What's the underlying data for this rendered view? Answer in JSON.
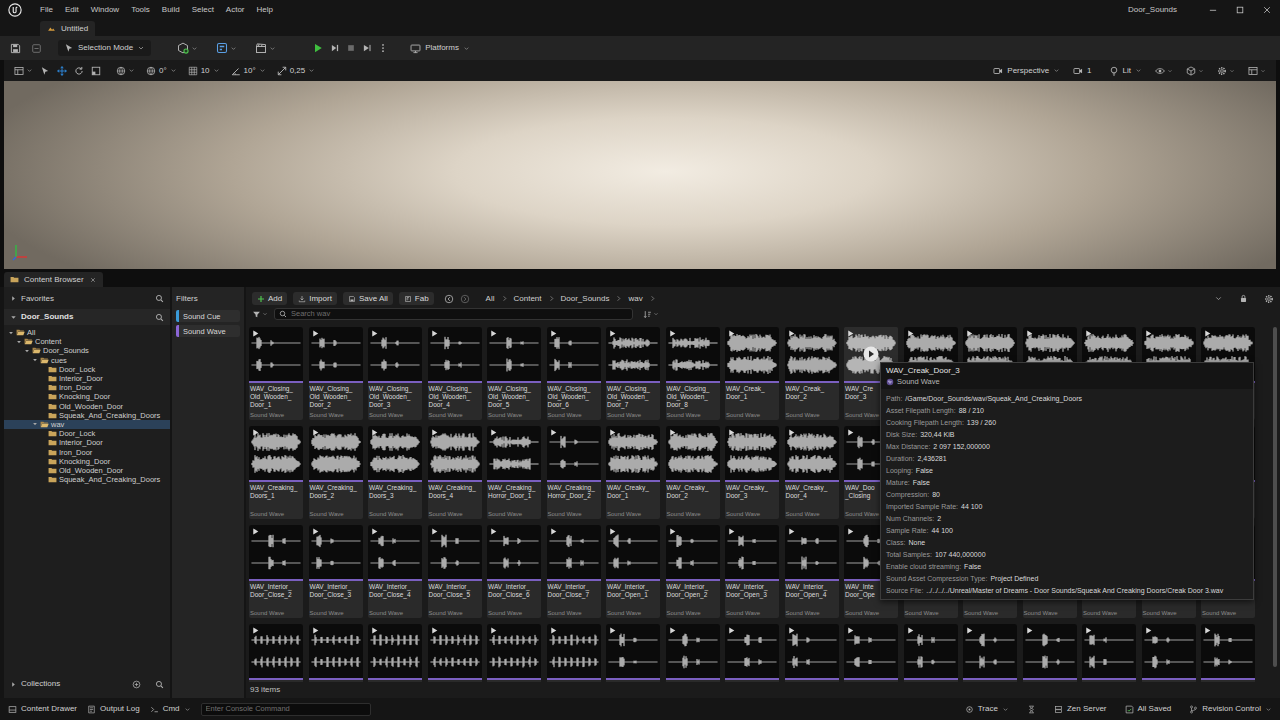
{
  "window": {
    "title": "Door_Sounds"
  },
  "menu": [
    "File",
    "Edit",
    "Window",
    "Tools",
    "Build",
    "Select",
    "Actor",
    "Help"
  ],
  "document_tab": {
    "label": "Untitled"
  },
  "main_toolbar": {
    "mode": "Selection Mode",
    "platforms": "Platforms"
  },
  "viewport_toolbar": {
    "snaps": [
      "0°",
      "10",
      "10°",
      "0,25"
    ],
    "camera": "Perspective",
    "speed": "1",
    "view_mode": "Lit"
  },
  "content_browser": {
    "tab": "Content Browser",
    "favorites": "Favorites",
    "root": "Door_Sounds",
    "tree": [
      {
        "label": "All",
        "depth": 0,
        "kind": "branch",
        "expanded": true,
        "selected": false
      },
      {
        "label": "Content",
        "depth": 1,
        "kind": "branch",
        "expanded": true,
        "selected": false
      },
      {
        "label": "Door_Sounds",
        "depth": 2,
        "kind": "branch",
        "expanded": true,
        "selected": false
      },
      {
        "label": "cues",
        "depth": 3,
        "kind": "branch",
        "expanded": true,
        "selected": false
      },
      {
        "label": "Door_Lock",
        "depth": 4,
        "kind": "leaf",
        "expanded": false,
        "selected": false
      },
      {
        "label": "Interior_Door",
        "depth": 4,
        "kind": "leaf",
        "expanded": false,
        "selected": false
      },
      {
        "label": "Iron_Door",
        "depth": 4,
        "kind": "leaf",
        "expanded": false,
        "selected": false
      },
      {
        "label": "Knocking_Door",
        "depth": 4,
        "kind": "leaf",
        "expanded": false,
        "selected": false
      },
      {
        "label": "Old_Wooden_Door",
        "depth": 4,
        "kind": "leaf",
        "expanded": false,
        "selected": false
      },
      {
        "label": "Squeak_And_Creaking_Doors",
        "depth": 4,
        "kind": "leaf",
        "expanded": false,
        "selected": false
      },
      {
        "label": "wav",
        "depth": 3,
        "kind": "branch",
        "expanded": true,
        "selected": true
      },
      {
        "label": "Door_Lock",
        "depth": 4,
        "kind": "leaf",
        "expanded": false,
        "selected": false
      },
      {
        "label": "Interior_Door",
        "depth": 4,
        "kind": "leaf",
        "expanded": false,
        "selected": false
      },
      {
        "label": "Iron_Door",
        "depth": 4,
        "kind": "leaf",
        "expanded": false,
        "selected": false
      },
      {
        "label": "Knocking_Door",
        "depth": 4,
        "kind": "leaf",
        "expanded": false,
        "selected": false
      },
      {
        "label": "Old_Wooden_Door",
        "depth": 4,
        "kind": "leaf",
        "expanded": false,
        "selected": false
      },
      {
        "label": "Squeak_And_Creaking_Doors",
        "depth": 4,
        "kind": "leaf",
        "expanded": false,
        "selected": false
      }
    ],
    "collections": "Collections",
    "filters_title": "Filters",
    "filters": [
      {
        "label": "Sound Cue",
        "color": "#3a9bd9"
      },
      {
        "label": "Sound Wave",
        "color": "#8b66d6"
      }
    ],
    "actions": [
      "Add",
      "Import",
      "Save All",
      "Fab"
    ],
    "breadcrumb": [
      "All",
      "Content",
      "Door_Sounds",
      "wav"
    ],
    "search": {
      "placeholder": "Search wav"
    },
    "tiles": [
      {
        "lines": [
          "WAV_Closing_",
          "Old_Wooden_",
          "Door_1"
        ],
        "type": "Sound Wave",
        "kind": "sparse",
        "hovered": false
      },
      {
        "lines": [
          "WAV_Closing_",
          "Old_Wooden_",
          "Door_2"
        ],
        "type": "Sound Wave",
        "kind": "sparse",
        "hovered": false
      },
      {
        "lines": [
          "WAV_Closing_",
          "Old_Wooden_",
          "Door_3"
        ],
        "type": "Sound Wave",
        "kind": "sparse",
        "hovered": false
      },
      {
        "lines": [
          "WAV_Closing_",
          "Old_Wooden_",
          "Door_4"
        ],
        "type": "Sound Wave",
        "kind": "sparse",
        "hovered": false
      },
      {
        "lines": [
          "WAV_Closing_",
          "Old_Wooden_",
          "Door_5"
        ],
        "type": "Sound Wave",
        "kind": "sparse",
        "hovered": false
      },
      {
        "lines": [
          "WAV_Closing_",
          "Old_Wooden_",
          "Door_6"
        ],
        "type": "Sound Wave",
        "kind": "sparse",
        "hovered": false
      },
      {
        "lines": [
          "WAV_Closing_",
          "Old_Wooden_",
          "Door_7"
        ],
        "type": "Sound Wave",
        "kind": "burst",
        "hovered": false
      },
      {
        "lines": [
          "WAV_Closing_",
          "Old_Wooden_",
          "Door_8"
        ],
        "type": "Sound Wave",
        "kind": "burst",
        "hovered": false
      },
      {
        "lines": [
          "WAV_Creak_",
          "Door_1"
        ],
        "type": "Sound Wave",
        "kind": "dense",
        "hovered": false
      },
      {
        "lines": [
          "WAV_Creak_",
          "Door_2"
        ],
        "type": "Sound Wave",
        "kind": "dense",
        "hovered": false
      },
      {
        "lines": [
          "WAV_Cre",
          "Door_3"
        ],
        "type": "Sound Wave",
        "kind": "dense",
        "hovered": true
      },
      {
        "lines": [],
        "type": "",
        "kind": "dense",
        "hovered": false
      },
      {
        "lines": [],
        "type": "",
        "kind": "dense",
        "hovered": false
      },
      {
        "lines": [],
        "type": "",
        "kind": "dense",
        "hovered": false
      },
      {
        "lines": [],
        "type": "",
        "kind": "dense",
        "hovered": false
      },
      {
        "lines": [],
        "type": "",
        "kind": "dense",
        "hovered": false
      },
      {
        "lines": [],
        "type": "",
        "kind": "dense",
        "hovered": false
      },
      {
        "lines": [
          "WAV_Creaking_",
          "Doors_1"
        ],
        "type": "Sound Wave",
        "kind": "dense",
        "hovered": false
      },
      {
        "lines": [
          "WAV_Creaking_",
          "Doors_2"
        ],
        "type": "Sound Wave",
        "kind": "dense",
        "hovered": false
      },
      {
        "lines": [
          "WAV_Creaking_",
          "Doors_3"
        ],
        "type": "Sound Wave",
        "kind": "dense",
        "hovered": false
      },
      {
        "lines": [
          "WAV_Creaking_",
          "Doors_4"
        ],
        "type": "Sound Wave",
        "kind": "dense",
        "hovered": false
      },
      {
        "lines": [
          "WAV_Creaking_",
          "Horror_Door_1"
        ],
        "type": "Sound Wave",
        "kind": "burst",
        "hovered": false
      },
      {
        "lines": [
          "WAV_Creaking_",
          "Horror_Door_2"
        ],
        "type": "Sound Wave",
        "kind": "sparse",
        "hovered": false
      },
      {
        "lines": [
          "WAV_Creaky_",
          "Door_1"
        ],
        "type": "Sound Wave",
        "kind": "dense",
        "hovered": false
      },
      {
        "lines": [
          "WAV_Creaky_",
          "Door_2"
        ],
        "type": "Sound Wave",
        "kind": "dense",
        "hovered": false
      },
      {
        "lines": [
          "WAV_Creaky_",
          "Door_3"
        ],
        "type": "Sound Wave",
        "kind": "dense",
        "hovered": false
      },
      {
        "lines": [
          "WAV_Creaky_",
          "Door_4"
        ],
        "type": "Sound Wave",
        "kind": "dense",
        "hovered": false
      },
      {
        "lines": [
          "WAV_Doo",
          "_Closing"
        ],
        "type": "Sound Wave",
        "kind": "sparse",
        "hovered": false
      },
      {
        "lines": [],
        "type": "",
        "kind": "dense",
        "hovered": false
      },
      {
        "lines": [],
        "type": "",
        "kind": "dense",
        "hovered": false
      },
      {
        "lines": [],
        "type": "",
        "kind": "dense",
        "hovered": false
      },
      {
        "lines": [],
        "type": "",
        "kind": "dense",
        "hovered": false
      },
      {
        "lines": [],
        "type": "",
        "kind": "dense",
        "hovered": false
      },
      {
        "lines": [],
        "type": "",
        "kind": "dense",
        "hovered": false
      },
      {
        "lines": [
          "WAV_Interior_",
          "Door_Close_2"
        ],
        "type": "Sound Wave",
        "kind": "sparse",
        "hovered": false
      },
      {
        "lines": [
          "WAV_Interior_",
          "Door_Close_3"
        ],
        "type": "Sound Wave",
        "kind": "sparse",
        "hovered": false
      },
      {
        "lines": [
          "WAV_Interior_",
          "Door_Close_4"
        ],
        "type": "Sound Wave",
        "kind": "sparse",
        "hovered": false
      },
      {
        "lines": [
          "WAV_Interior_",
          "Door_Close_5"
        ],
        "type": "Sound Wave",
        "kind": "sparse",
        "hovered": false
      },
      {
        "lines": [
          "WAV_Interior_",
          "Door_Close_6"
        ],
        "type": "Sound Wave",
        "kind": "sparse",
        "hovered": false
      },
      {
        "lines": [
          "WAV_Interior_",
          "Door_Close_7"
        ],
        "type": "Sound Wave",
        "kind": "sparse",
        "hovered": false
      },
      {
        "lines": [
          "WAV_Interior_",
          "Door_Open_1"
        ],
        "type": "Sound Wave",
        "kind": "sparse",
        "hovered": false
      },
      {
        "lines": [
          "WAV_Interior_",
          "Door_Open_2"
        ],
        "type": "Sound Wave",
        "kind": "sparse",
        "hovered": false
      },
      {
        "lines": [
          "WAV_Interior_",
          "Door_Open_3"
        ],
        "type": "Sound Wave",
        "kind": "sparse",
        "hovered": false
      },
      {
        "lines": [
          "WAV_Interior_",
          "Door_Open_4"
        ],
        "type": "Sound Wave",
        "kind": "sparse",
        "hovered": false
      },
      {
        "lines": [
          "WAV_Inte",
          "Door_Ope"
        ],
        "type": "Sound Wave",
        "kind": "sparse",
        "hovered": false
      },
      {
        "lines": [],
        "type": "Sound Wave",
        "kind": "sparse",
        "hovered": false
      },
      {
        "lines": [],
        "type": "Sound Wave",
        "kind": "sparse",
        "hovered": false
      },
      {
        "lines": [],
        "type": "Sound Wave",
        "kind": "sparse",
        "hovered": false
      },
      {
        "lines": [],
        "type": "Sound Wave",
        "kind": "sparse",
        "hovered": false
      },
      {
        "lines": [],
        "type": "Sound Wave",
        "kind": "sparse",
        "hovered": false
      },
      {
        "lines": [],
        "type": "Sound Wave",
        "kind": "sparse",
        "hovered": false
      },
      {
        "lines": [],
        "type": "",
        "kind": "pulse",
        "hovered": false
      },
      {
        "lines": [],
        "type": "",
        "kind": "pulse",
        "hovered": false
      },
      {
        "lines": [],
        "type": "",
        "kind": "pulse",
        "hovered": false
      },
      {
        "lines": [],
        "type": "",
        "kind": "pulse",
        "hovered": false
      },
      {
        "lines": [],
        "type": "",
        "kind": "pulse",
        "hovered": false
      },
      {
        "lines": [],
        "type": "",
        "kind": "pulse",
        "hovered": false
      },
      {
        "lines": [],
        "type": "",
        "kind": "sparse",
        "hovered": false
      },
      {
        "lines": [],
        "type": "",
        "kind": "sparse",
        "hovered": false
      },
      {
        "lines": [],
        "type": "",
        "kind": "sparse",
        "hovered": false
      },
      {
        "lines": [],
        "type": "",
        "kind": "sparse",
        "hovered": false
      },
      {
        "lines": [],
        "type": "",
        "kind": "sparse",
        "hovered": false
      },
      {
        "lines": [],
        "type": "",
        "kind": "sparse",
        "hovered": false
      },
      {
        "lines": [],
        "type": "",
        "kind": "sparse",
        "hovered": false
      },
      {
        "lines": [],
        "type": "",
        "kind": "sparse",
        "hovered": false
      },
      {
        "lines": [],
        "type": "",
        "kind": "sparse",
        "hovered": false
      },
      {
        "lines": [],
        "type": "",
        "kind": "sparse",
        "hovered": false
      },
      {
        "lines": [],
        "type": "",
        "kind": "sparse",
        "hovered": false
      }
    ],
    "item_count": "93 items",
    "tooltip": {
      "title": "WAV_Creak_Door_3",
      "type": "Sound Wave",
      "rows": [
        {
          "key": "Path:",
          "value": "/Game/Door_Sounds/wav/Squeak_And_Creaking_Doors"
        },
        {
          "key": "Asset Filepath Length:",
          "value": "88 / 210"
        },
        {
          "key": "Cooking Filepath Length:",
          "value": "139 / 260"
        },
        {
          "key": "Disk Size:",
          "value": "320,44 KiB"
        },
        {
          "key": "Max Distance:",
          "value": "2 097 152,000000"
        },
        {
          "key": "Duration:",
          "value": "2,436281"
        },
        {
          "key": "Looping:",
          "value": "False"
        },
        {
          "key": "Mature:",
          "value": "False"
        },
        {
          "key": "Compression:",
          "value": "80"
        },
        {
          "key": "Imported Sample Rate:",
          "value": "44 100"
        },
        {
          "key": "Num Channels:",
          "value": "2"
        },
        {
          "key": "Sample Rate:",
          "value": "44 100"
        },
        {
          "key": "Class:",
          "value": "None"
        },
        {
          "key": "Total Samples:",
          "value": "107 440,000000"
        },
        {
          "key": "Enable cloud streaming:",
          "value": "False"
        },
        {
          "key": "Sound Asset Compression Type:",
          "value": "Project Defined"
        },
        {
          "key": "Source File:",
          "value": "../../../../Unreal/Master of Dreams - Door Sounds/Squeak And Creaking Doors/Creak Door 3.wav"
        }
      ]
    }
  },
  "status_bar": {
    "left": [
      "Content Drawer",
      "Output Log",
      "Cmd"
    ],
    "console_placeholder": "Enter Console Command",
    "right": [
      "Trace",
      "Zen Server",
      "All Saved",
      "Revision Control"
    ]
  }
}
